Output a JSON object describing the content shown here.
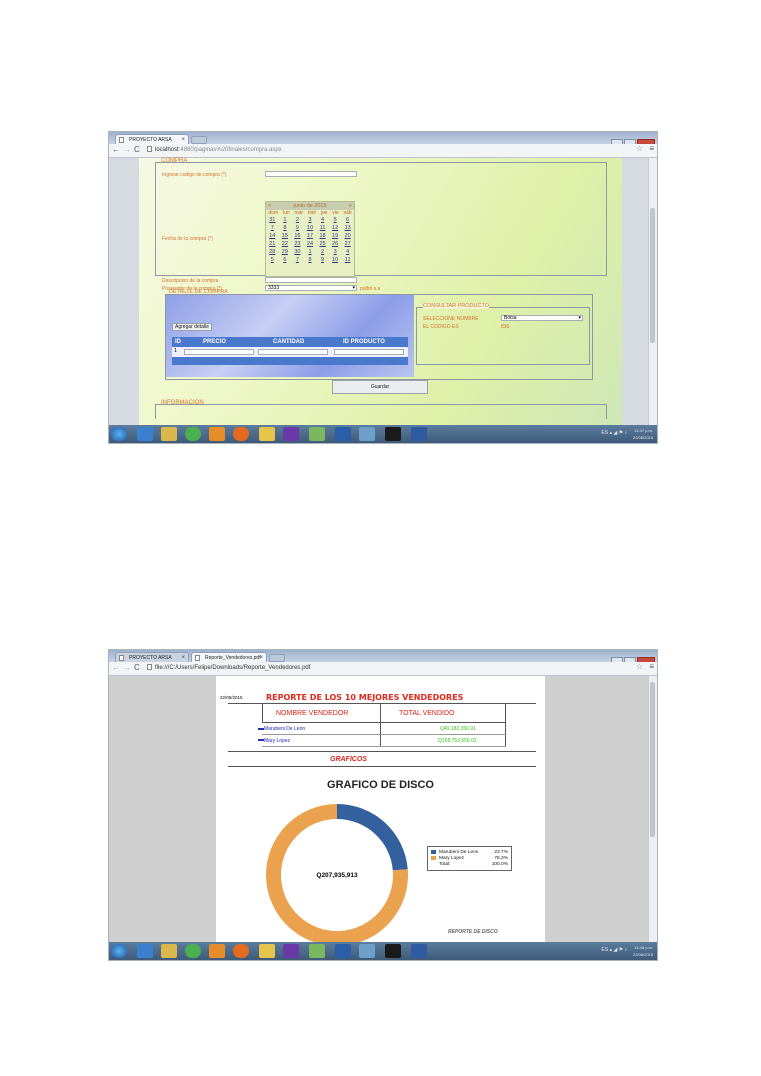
{
  "screenshot1": {
    "tab": {
      "title": "PROYECTO ARSA",
      "close": "×"
    },
    "url": {
      "host": "localhost",
      "path": ":4880/paginas%20finales/compra.aspx"
    },
    "form": {
      "legend_compra": "COMPRA",
      "label_codigo": "Ingrese codigo de compra (*)",
      "label_fecha": "Fecha de la compra (*)",
      "label_descripcion": "Descripcion de la compra",
      "label_proveedor": "Proveedor de la compra (*)",
      "proveedor_value": "3333",
      "proveedor_extra": "pulbri s.a",
      "calendar": {
        "prev": "<",
        "next": ">",
        "month": "junio de 2015",
        "day_names": [
          "dom",
          "lun",
          "mar",
          "mié",
          "jue",
          "vie",
          "sáb"
        ],
        "weeks": [
          [
            "31",
            "1",
            "2",
            "3",
            "4",
            "5",
            "6"
          ],
          [
            "7",
            "8",
            "9",
            "10",
            "11",
            "12",
            "13"
          ],
          [
            "14",
            "15",
            "16",
            "17",
            "18",
            "19",
            "20"
          ],
          [
            "21",
            "22",
            "23",
            "24",
            "25",
            "26",
            "27"
          ],
          [
            "28",
            "29",
            "30",
            "1",
            "2",
            "3",
            "4"
          ],
          [
            "5",
            "6",
            "7",
            "8",
            "9",
            "10",
            "11"
          ]
        ]
      },
      "legend_detalle": "DETALLE DE COMPRA",
      "agregar_label": "Agregar detalle",
      "table_headers": [
        "ID",
        "PRECIO",
        "CANTIDAD",
        "ID PRODUCTO"
      ],
      "row_id": "1",
      "consultar": {
        "legend": "CONSULTAR PRODUCTO",
        "label_nombre": "SELECCIONE NOMBRE",
        "nombre_value": "Bolsa",
        "label_codigo": "EL CODIGO ES",
        "codigo_value": "830"
      },
      "guardar_label": "Guardar",
      "legend_informacion": "INFORMACION"
    },
    "tray": {
      "lang": "ES",
      "time": "11:47 p.m.",
      "date": "22/06/2015"
    }
  },
  "screenshot2": {
    "tab1": {
      "title": "PROYECTO ARSA",
      "close": "×"
    },
    "tab2": {
      "title": "Reporte_Vendedores.pdf",
      "close": "×"
    },
    "url": "file:///C:/Users/Felipe/Downloads/Reporte_Vendedores.pdf",
    "report": {
      "date": "22/06/2015",
      "title": "REPORTE DE LOS 10 MEJORES VENDEDORES",
      "col_nombre": "NOMBRE VENDEDOR",
      "col_total": "TOTAL VENDIDO",
      "rows": [
        {
          "name": "Marubeni De Leon",
          "total": "Q49,182,356.91"
        },
        {
          "name": "Mary Lopez",
          "total": "Q158,753,556.02"
        }
      ],
      "graficos": "GRAFICOS",
      "chart_title": "GRAFICO DE DISCO",
      "center_label": "Q207,935,913",
      "legend_total_label": "Total:",
      "legend_total_pct": "100.0%",
      "footer": "REPORTE DE DISCO"
    },
    "tray": {
      "lang": "ES",
      "time": "11:48 p.m.",
      "date": "22/06/2015"
    }
  },
  "chart_data": {
    "type": "pie",
    "title": "GRAFICO DE DISCO",
    "categories": [
      "Marubeni De Leon",
      "Mary Lopez"
    ],
    "values": [
      23.7,
      76.3
    ],
    "labels": [
      "23.7%",
      "76.3%"
    ],
    "colors": [
      "#34609e",
      "#eba24f"
    ],
    "legend": "right"
  }
}
